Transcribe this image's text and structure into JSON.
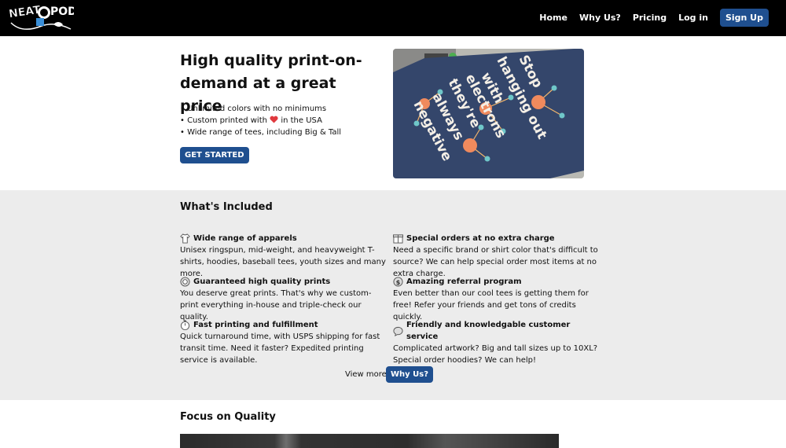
{
  "nav": {
    "links": [
      "Home",
      "Why Us?",
      "Pricing",
      "Log in"
    ],
    "signup": "Sign Up"
  },
  "hero": {
    "title": "High quality print-on-demand at a great price",
    "bullets": {
      "b1": "Unlimited colors with no minimums",
      "b2_pre": "Custom printed with",
      "b2_post": "in the USA",
      "b3": "Wide range of tees, including Big & Tall"
    },
    "cta": "GET STARTED",
    "shirt_text": [
      "Stop",
      "hanging out",
      "with",
      "electrons",
      "they're",
      "always",
      "negative"
    ]
  },
  "included": {
    "title": "What's Included",
    "features": [
      {
        "icon": "tshirt-icon",
        "title": "Wide range of apparels",
        "desc": "Unisex ringspun, mid-weight, and heavyweight T-shirts, hoodies, baseball tees, youth sizes and many more."
      },
      {
        "icon": "box-icon",
        "title": "Special orders at no extra charge",
        "desc": "Need a specific brand or shirt color that's difficult to source? We can help special order most items at no extra charge."
      },
      {
        "icon": "badge-icon",
        "title": "Guaranteed high quality prints",
        "desc": "You deserve great prints. That's why we custom-print everything in-house and triple-check our quality."
      },
      {
        "icon": "dollar-icon",
        "title": "Amazing referral program",
        "desc": "Even better than our cool tees is getting them for free! Refer your friends and get tons of credits quickly."
      },
      {
        "icon": "stopwatch-icon",
        "title": "Fast printing and fulfillment",
        "desc": "Quick turnaround time, with USPS shipping for fast transit time. Need it faster? Expedited printing service is available."
      },
      {
        "icon": "chat-icon",
        "title": "Friendly and knowledgable customer service",
        "desc": "Complicated artwork? Big and tall sizes up to 10XL? Special order hoodies? We can help!"
      }
    ],
    "view_more": "View more:",
    "view_btn": "Why Us?"
  },
  "quality": {
    "title": "Focus on Quality"
  },
  "colors": {
    "nav_bg": "#000000",
    "button": "#1f4f8f",
    "section_bg": "#ececec",
    "shirt": "#34466b"
  }
}
